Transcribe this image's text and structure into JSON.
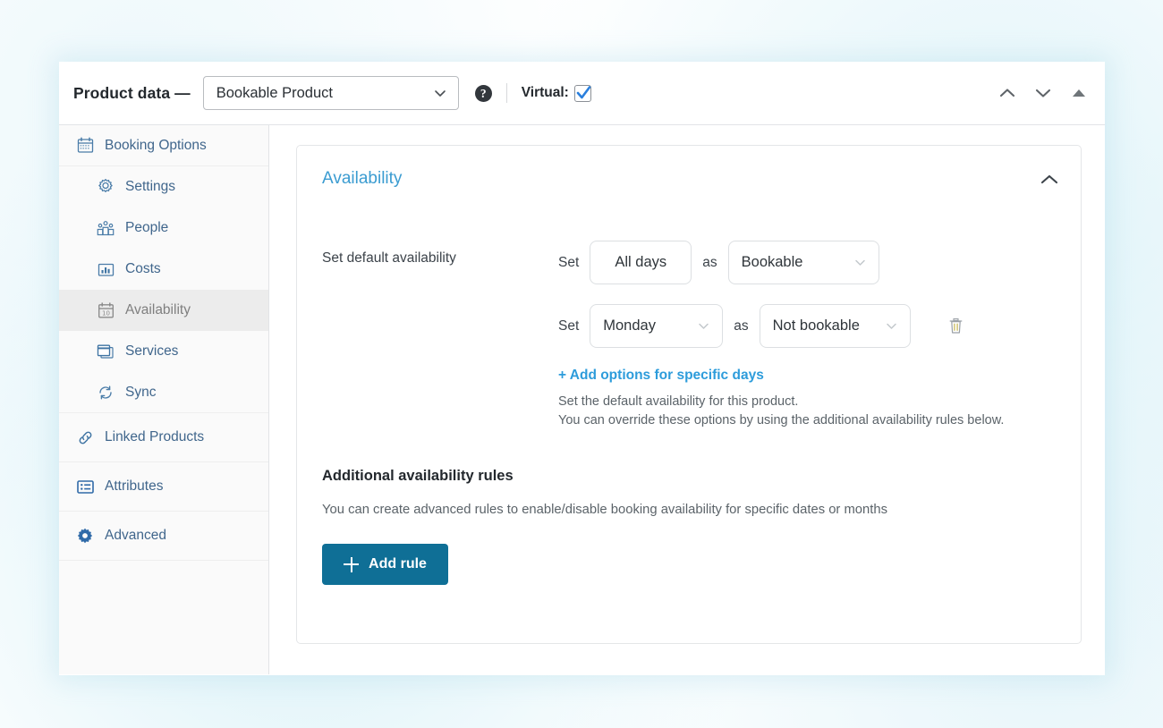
{
  "header": {
    "title": "Product data —",
    "product_type": "Bookable Product",
    "help_icon": "help-circle-icon",
    "virtual_label": "Virtual:",
    "virtual_checked": true,
    "controls": [
      "chevron-up-icon",
      "chevron-down-icon",
      "triangle-up-icon"
    ]
  },
  "sidebar": {
    "items": [
      {
        "label": "Booking Options",
        "icon": "calendar-icon",
        "level": 0,
        "active": false
      },
      {
        "label": "Settings",
        "icon": "gear-icon",
        "level": 1,
        "active": false
      },
      {
        "label": "People",
        "icon": "people-icon",
        "level": 1,
        "active": false
      },
      {
        "label": "Costs",
        "icon": "bar-chart-icon",
        "level": 1,
        "active": false
      },
      {
        "label": "Availability",
        "icon": "calendar-10-icon",
        "level": 1,
        "active": true
      },
      {
        "label": "Services",
        "icon": "window-icon",
        "level": 1,
        "active": false
      },
      {
        "label": "Sync",
        "icon": "sync-icon",
        "level": 1,
        "active": false
      },
      {
        "label": "Linked Products",
        "icon": "link-icon",
        "level": 0,
        "active": false
      },
      {
        "label": "Attributes",
        "icon": "list-icon",
        "level": 0,
        "active": false
      },
      {
        "label": "Advanced",
        "icon": "cog-icon",
        "level": 0,
        "active": false
      }
    ]
  },
  "panel": {
    "title": "Availability",
    "collapse_icon": "chevron-up-icon",
    "default_availability": {
      "label": "Set default availability",
      "rows": [
        {
          "set_word": "Set",
          "day": "All days",
          "day_has_chevron": false,
          "as_word": "as",
          "status": "Bookable",
          "status_has_chevron": true,
          "has_delete": false
        },
        {
          "set_word": "Set",
          "day": "Monday",
          "day_has_chevron": true,
          "as_word": "as",
          "status": "Not bookable",
          "status_has_chevron": true,
          "has_delete": true,
          "delete_icon": "trash-icon"
        }
      ],
      "add_link": "+ Add options for specific days",
      "hint_line_1": "Set the default availability for this product.",
      "hint_line_2": "You can override these options by using the additional availability rules below."
    },
    "additional_rules": {
      "heading": "Additional availability rules",
      "description": "You can create advanced rules to enable/disable booking availability for specific dates or months",
      "add_rule_label": "Add rule",
      "add_rule_icon": "plus-icon"
    }
  },
  "colors": {
    "panel_title": "#3b9cd1",
    "link": "#2d9cdb",
    "primary_button": "#0f6f96",
    "nav_label": "#40668c",
    "active_nav_bg": "#ececec",
    "checkbox_check": "#2a7fdd"
  }
}
